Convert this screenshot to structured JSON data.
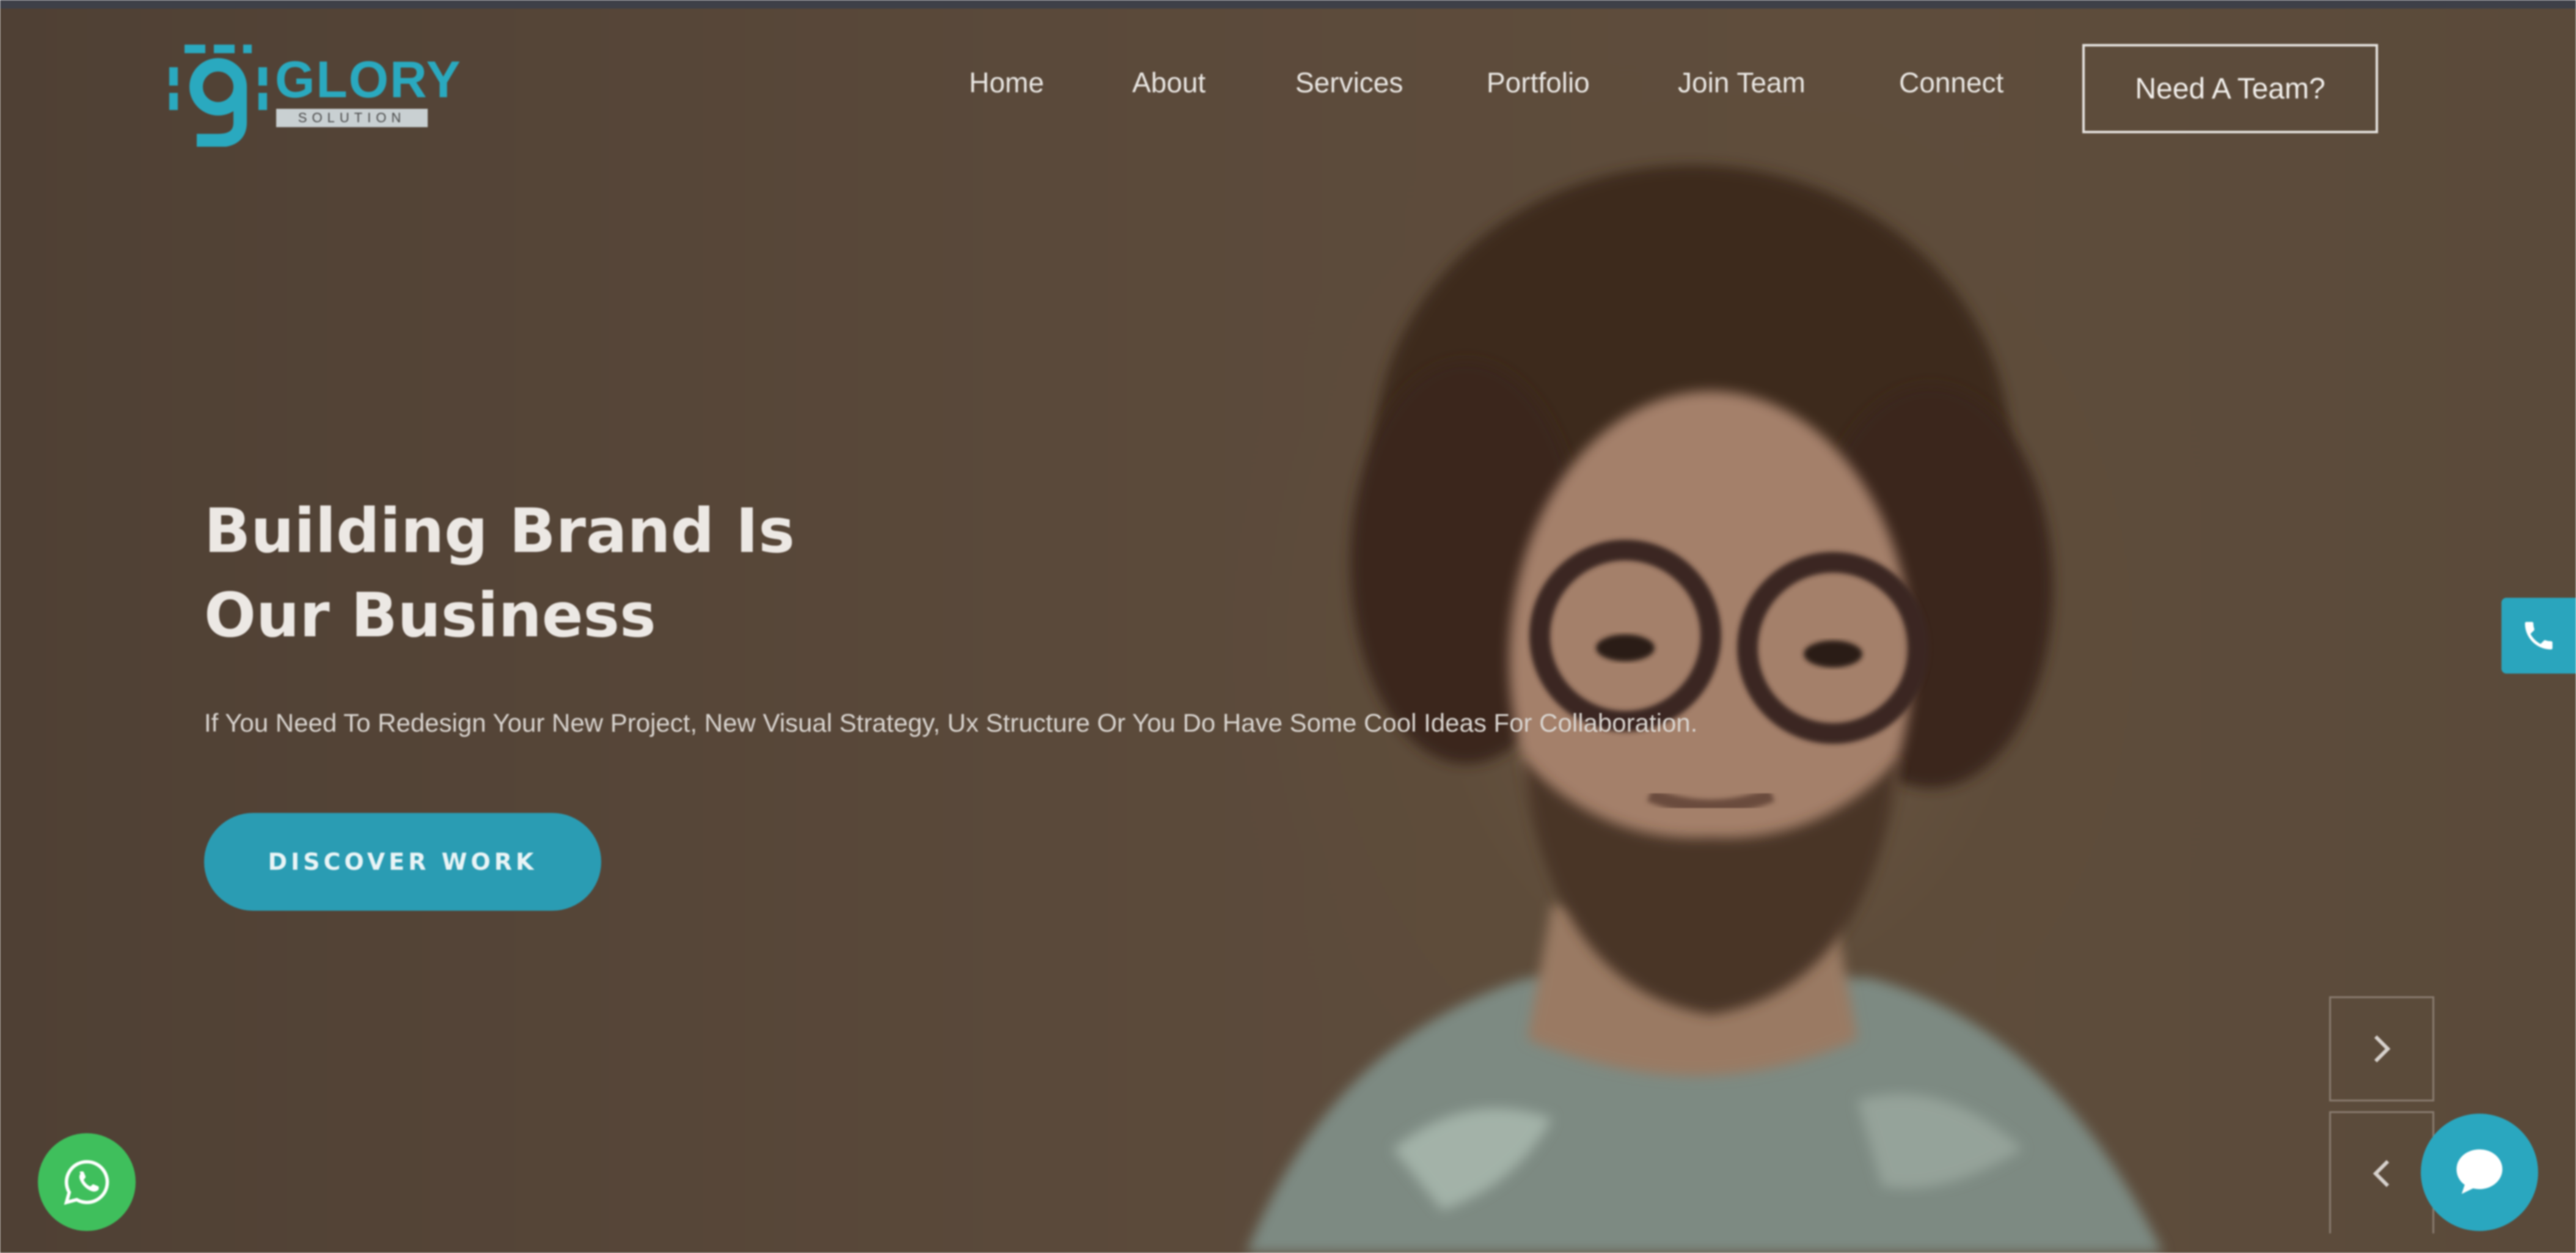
{
  "header": {
    "logo": {
      "wordmark": "GLORY",
      "tagline": "SOLUTION"
    },
    "nav": [
      {
        "label": "Home"
      },
      {
        "label": "About"
      },
      {
        "label": "Services"
      },
      {
        "label": "Portfolio"
      },
      {
        "label": "Join Team"
      },
      {
        "label": "Connect"
      }
    ],
    "cta_label": "Need A Team?"
  },
  "hero": {
    "title_line1": "Building Brand Is",
    "title_line2": "Our Business",
    "subtitle": "If You Need To Redesign Your New Project, New Visual Strategy, Ux Structure Or You Do Have Some Cool Ideas For Collaboration.",
    "button_label": "DISCOVER WORK"
  },
  "colors": {
    "accent": "#2aa5bd",
    "whatsapp": "#3fbf5c",
    "overlay": "#5a4a3a"
  },
  "icons": {
    "phone": "phone-icon",
    "whatsapp": "whatsapp-icon",
    "chat": "chat-icon",
    "next": "chevron-right-icon",
    "prev": "chevron-left-icon"
  }
}
